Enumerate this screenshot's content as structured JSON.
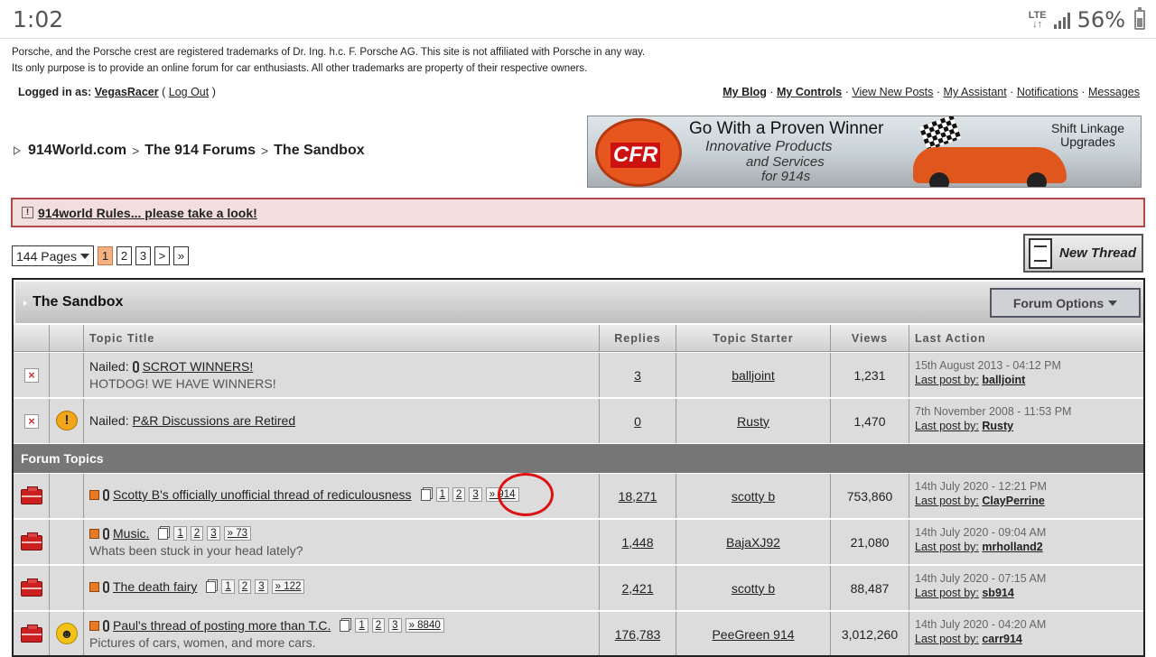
{
  "status_bar": {
    "time": "1:02",
    "network": "LTE",
    "battery": "56%",
    "battery_level": 0.56
  },
  "disclaimer": {
    "line1": "Porsche, and the Porsche crest are registered trademarks of Dr. Ing. h.c. F. Porsche AG. This site is not affiliated with Porsche in any way.",
    "line2": "Its only purpose is to provide an online forum for car enthusiasts. All other trademarks are property of their respective owners."
  },
  "user": {
    "logged_in_label": "Logged in as:",
    "username": "VegasRacer",
    "logout": "Log Out"
  },
  "top_links": [
    "My Blog",
    "My Controls",
    "View New Posts",
    "My Assistant",
    "Notifications",
    "Messages"
  ],
  "breadcrumb": [
    "914World.com",
    "The 914 Forums",
    "The Sandbox"
  ],
  "ad": {
    "logo": "CFR",
    "headline": "Go With a Proven Winner",
    "line1": "Innovative Products",
    "line2": "and Services",
    "line3": "for 914s",
    "side_line1": "Shift Linkage",
    "side_line2": "Upgrades"
  },
  "rules_link": "914world Rules... please take a look!",
  "pagination": {
    "pages_label": "144 Pages",
    "pages": [
      "1",
      "2",
      "3",
      ">",
      "»"
    ],
    "current": "1"
  },
  "new_thread_label": "New Thread",
  "forum": {
    "title": "The Sandbox",
    "options_label": "Forum Options",
    "columns": [
      "Topic Title",
      "Replies",
      "Topic Starter",
      "Views",
      "Last Action"
    ],
    "section_label": "Forum Topics",
    "pinned": [
      {
        "prefix": "Nailed:",
        "title": "SCROT WINNERS!",
        "subtitle": "HOTDOG! WE HAVE WINNERS!",
        "replies": "3",
        "starter": "balljoint",
        "views": "1,231",
        "date": "15th August 2013 - 04:12 PM",
        "last_by_label": "Last post by:",
        "last_by": "balljoint"
      },
      {
        "prefix": "Nailed:",
        "title": "P&R Discussions are Retired",
        "subtitle": "",
        "replies": "0",
        "starter": "Rusty",
        "views": "1,470",
        "date": "7th November 2008 - 11:53 PM",
        "last_by_label": "Last post by:",
        "last_by": "Rusty"
      }
    ],
    "topics": [
      {
        "title": "Scotty B's officially unofficial thread of rediculousness",
        "pages": [
          "1",
          "2",
          "3"
        ],
        "last_page": "» 914",
        "subtitle": "",
        "replies": "18,271",
        "starter": "scotty b",
        "views": "753,860",
        "date": "14th July 2020 - 12:21 PM",
        "last_by_label": "Last post by:",
        "last_by": "ClayPerrine"
      },
      {
        "title": "Music.",
        "pages": [
          "1",
          "2",
          "3"
        ],
        "last_page": "» 73",
        "subtitle": "Whats been stuck in your head lately?",
        "replies": "1,448",
        "starter": "BajaXJ92",
        "views": "21,080",
        "date": "14th July 2020 - 09:04 AM",
        "last_by_label": "Last post by:",
        "last_by": "mrholland2"
      },
      {
        "title": "The death fairy",
        "pages": [
          "1",
          "2",
          "3"
        ],
        "last_page": "» 122",
        "subtitle": "",
        "replies": "2,421",
        "starter": "scotty b",
        "views": "88,487",
        "date": "14th July 2020 - 07:15 AM",
        "last_by_label": "Last post by:",
        "last_by": "sb914"
      },
      {
        "title": "Paul's thread of posting more than T.C.",
        "pages": [
          "1",
          "2",
          "3"
        ],
        "last_page": "» 8840",
        "subtitle": "Pictures of cars, women, and more cars.",
        "replies": "176,783",
        "starter": "PeeGreen 914",
        "views": "3,012,260",
        "date": "14th July 2020 - 04:20 AM",
        "last_by_label": "Last post by:",
        "last_by": "carr914"
      }
    ]
  },
  "colors": {
    "rules_bg": "#f3dedf",
    "rules_border": "#b24a4a",
    "current_page": "#f4b183",
    "section_bg": "#777777",
    "highlight_circle": "#dd1111"
  }
}
